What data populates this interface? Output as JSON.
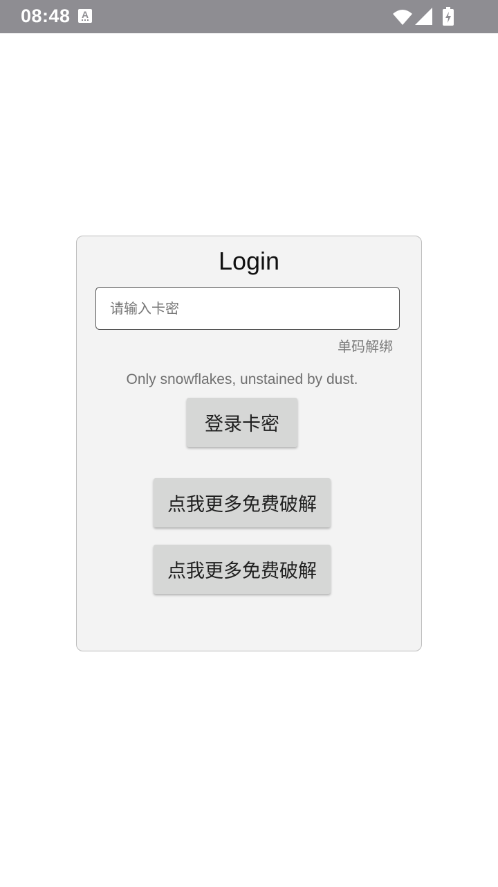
{
  "status_bar": {
    "time": "08:48",
    "notification_icon_letter": "A",
    "icons": [
      "wifi-icon",
      "cellular-signal-icon",
      "battery-charging-icon"
    ],
    "background_color": "#8e8d92"
  },
  "login_card": {
    "title": "Login",
    "card_key_input": {
      "value": "",
      "placeholder": "请输入卡密"
    },
    "unbind_link": "单码解绑",
    "quote": "Only snowflakes, unstained by dust.",
    "login_button": "登录卡密",
    "more_buttons": [
      "点我更多免费破解",
      "点我更多免费破解"
    ],
    "background_color": "#f3f3f3",
    "button_color": "#d6d7d6"
  }
}
